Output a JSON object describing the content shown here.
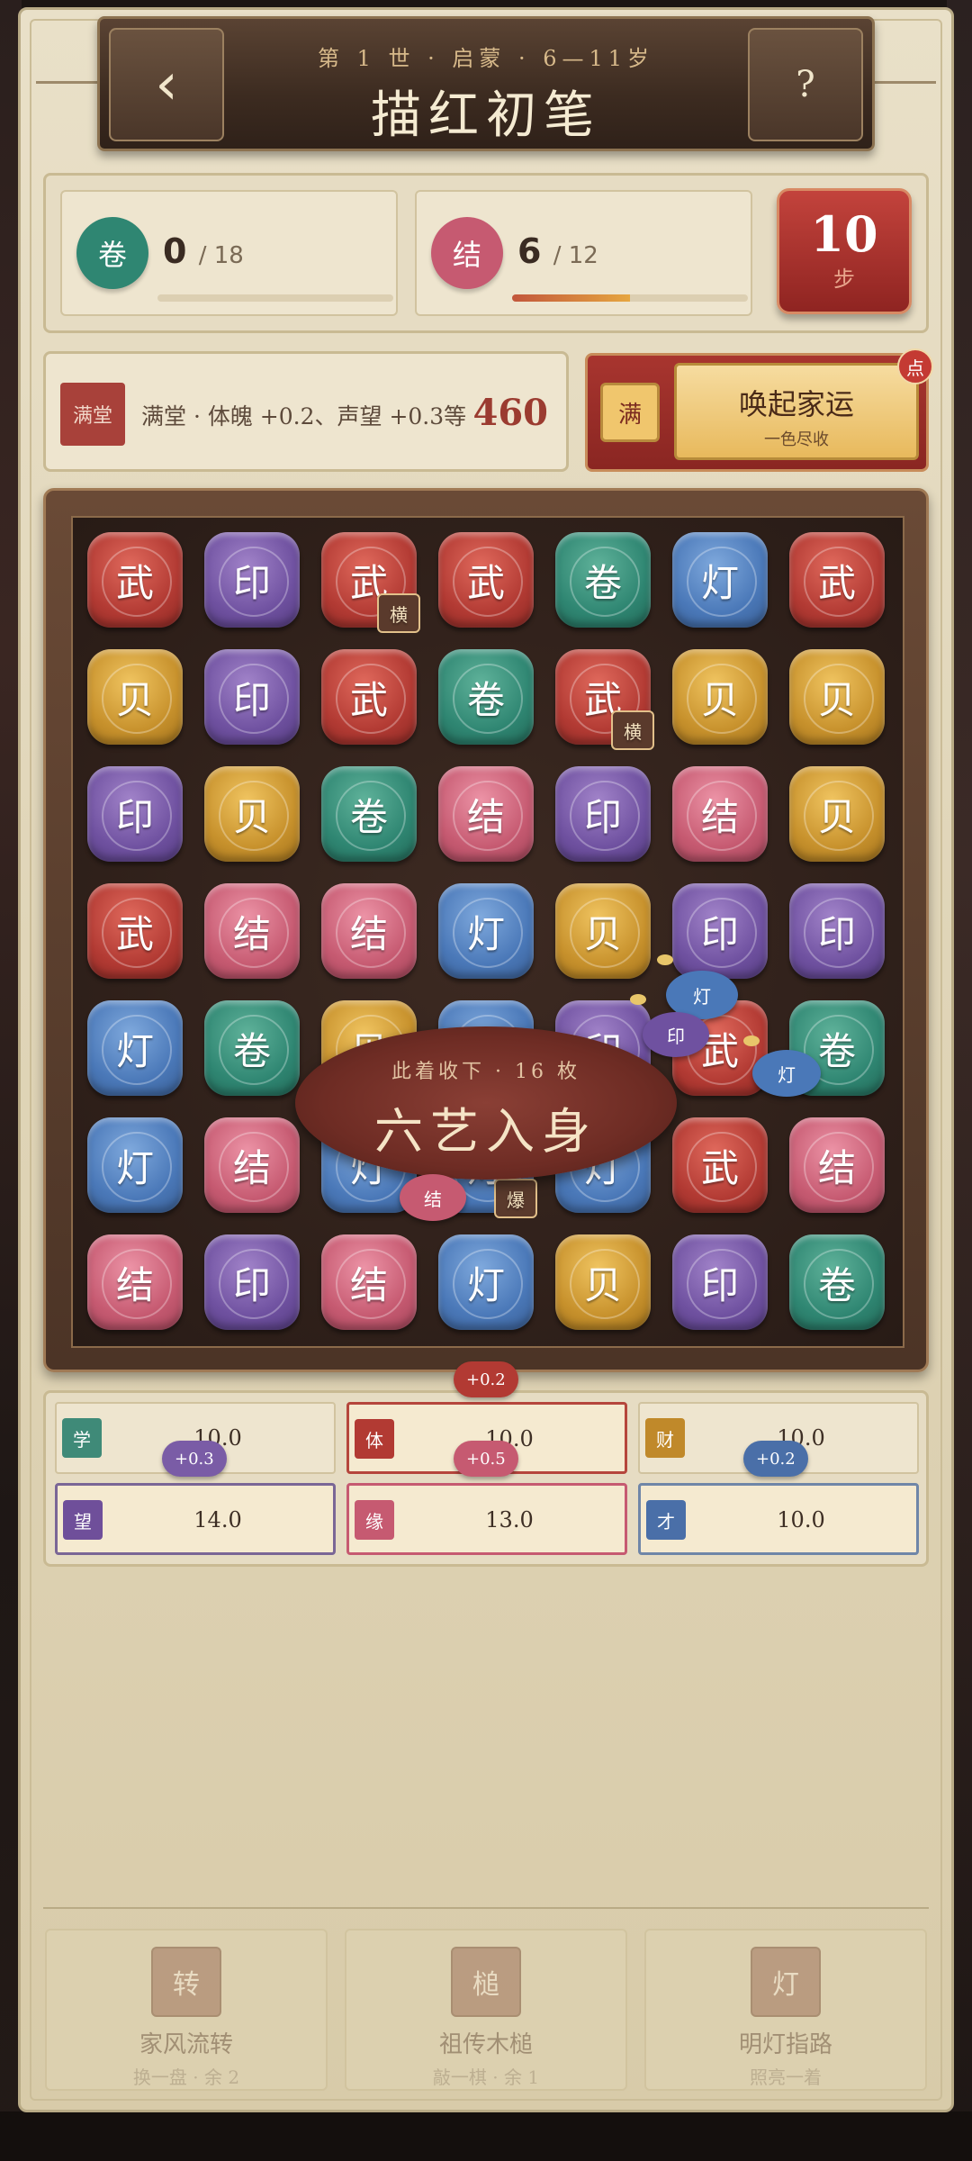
{
  "header": {
    "back_label": "‹",
    "help_label": "?",
    "subtitle": "第 1 世 · 启蒙 · 6—11岁",
    "title": "描红初笔"
  },
  "goals": [
    {
      "icon_char": "卷",
      "count": "0",
      "total": "/ 18",
      "color": "#2f8672",
      "progress": 0.0
    },
    {
      "icon_char": "结",
      "count": "6",
      "total": "/ 12",
      "color": "#c65a71",
      "progress": 0.5
    }
  ],
  "steps": {
    "value": "10",
    "label": "步"
  },
  "combo": {
    "tag": "满堂",
    "desc": "满堂 · 体魄 +0.2、声望 +0.3等",
    "score": "460"
  },
  "summon": {
    "badge": "满",
    "title": "唤起家运",
    "subtitle": "一色尽收",
    "dot": "点"
  },
  "board": {
    "rows": [
      [
        "武",
        "印",
        "武",
        "武",
        "卷",
        "灯",
        "武"
      ],
      [
        "贝",
        "印",
        "武",
        "卷",
        "武",
        "贝",
        "贝"
      ],
      [
        "印",
        "贝",
        "卷",
        "结",
        "印",
        "结",
        "贝"
      ],
      [
        "武",
        "结",
        "结",
        "灯",
        "贝",
        "印",
        "印"
      ],
      [
        "灯",
        "卷",
        "贝",
        "灯",
        "印",
        "武",
        "卷"
      ],
      [
        "灯",
        "结",
        "灯",
        "灯",
        "灯",
        "武",
        "结"
      ],
      [
        "结",
        "印",
        "结",
        "灯",
        "贝",
        "印",
        "卷"
      ]
    ],
    "markers": [
      {
        "row": 0,
        "col": 2,
        "label": "横"
      },
      {
        "row": 1,
        "col": 4,
        "label": "横"
      },
      {
        "row": 5,
        "col": 3,
        "label": "爆"
      }
    ],
    "flying": [
      "灯",
      "印",
      "灯",
      "结"
    ]
  },
  "banner": {
    "sub": "此着收下 · 16 枚",
    "main": "六艺入身"
  },
  "attributes": [
    {
      "icon": "学",
      "value": "10.0",
      "color": "#3f8a78",
      "delta": "+0.3",
      "delta_color": "#7a5ca6"
    },
    {
      "icon": "体",
      "value": "10.0",
      "color": "#b23a33",
      "delta": "+0.2",
      "delta_color": "#b23a33"
    },
    {
      "icon": "财",
      "value": "10.0",
      "color": "#c0892a",
      "delta": "+0.2",
      "delta_color": "#4a6fa8"
    },
    {
      "icon": "望",
      "value": "14.0",
      "color": "#6f4f9a",
      "delta": "",
      "delta_color": ""
    },
    {
      "icon": "缘",
      "value": "13.0",
      "color": "#c65a71",
      "delta": "+0.5",
      "delta_color": "#c65a71"
    },
    {
      "icon": "才",
      "value": "10.0",
      "color": "#4a6fa8",
      "delta": "",
      "delta_color": ""
    }
  ],
  "tools": [
    {
      "icon": "转",
      "name": "家风流转",
      "sub": "换一盘 · 余 2"
    },
    {
      "icon": "槌",
      "name": "祖传木槌",
      "sub": "敲一棋 · 余 1"
    },
    {
      "icon": "灯",
      "name": "明灯指路",
      "sub": "照亮一着"
    }
  ]
}
